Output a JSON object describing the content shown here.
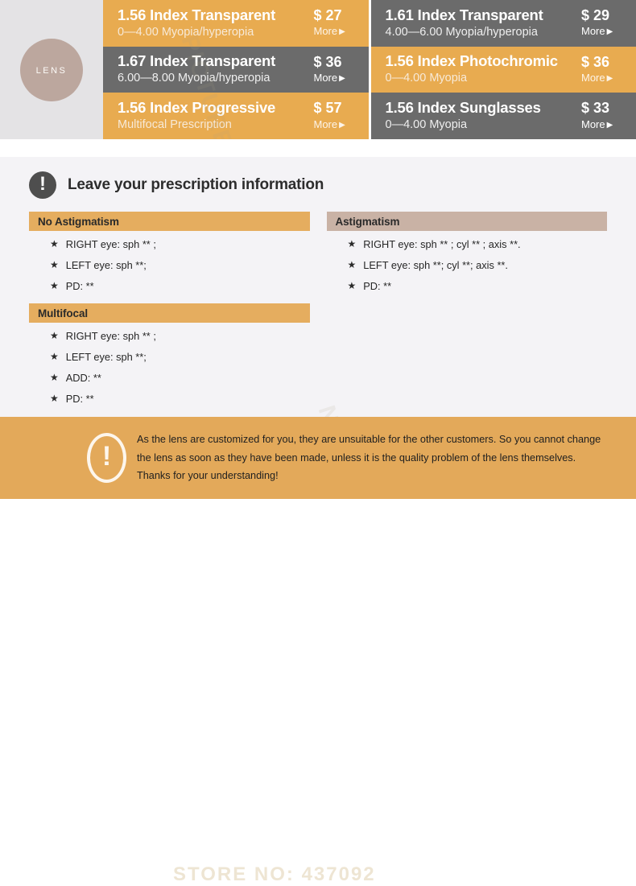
{
  "brand": {
    "badge_label": "LENS"
  },
  "lens_options": [
    {
      "title": "1.56 Index Transparent",
      "subtitle": "0—4.00 Myopia/hyperopia",
      "price": "$ 27",
      "more_label": "More",
      "more_arrow": "▶",
      "theme": "orange"
    },
    {
      "title": "1.61 Index Transparent",
      "subtitle": "4.00—6.00 Myopia/hyperopia",
      "price": "$ 29",
      "more_label": "More",
      "more_arrow": "▶",
      "theme": "gray"
    },
    {
      "title": "1.67 Index Transparent",
      "subtitle": "6.00—8.00 Myopia/hyperopia",
      "price": "$ 36",
      "more_label": "More",
      "more_arrow": "▶",
      "theme": "gray"
    },
    {
      "title": "1.56 Index Photochromic",
      "subtitle": "0—4.00 Myopia",
      "price": "$ 36",
      "more_label": "More",
      "more_arrow": "▶",
      "theme": "orange"
    },
    {
      "title": "1.56 Index Progressive",
      "subtitle": "Multifocal Prescription",
      "price": "$ 57",
      "more_label": "More",
      "more_arrow": "▶",
      "theme": "orange"
    },
    {
      "title": "1.56 Index Sunglasses",
      "subtitle": "0—4.00 Myopia",
      "price": "$ 33",
      "more_label": "More",
      "more_arrow": "▶",
      "theme": "gray"
    }
  ],
  "prescription": {
    "heading": "Leave your prescription information",
    "icon": "exclamation-icon",
    "bullet_glyph": "★",
    "groups": [
      {
        "id": "no-astigmatism",
        "label": "No Astigmatism",
        "bar_color": "#e5ad5f",
        "items": [
          "RIGHT eye:  sph ** ;",
          "LEFT   eye:  sph **;",
          "PD: **"
        ]
      },
      {
        "id": "astigmatism",
        "label": "Astigmatism",
        "bar_color": "#c9b2a5",
        "items": [
          "RIGHT eye:  sph ** ; cyl ** ; axis **.",
          "LEFT   eye:  sph **;  cyl **;  axis **.",
          "PD: **"
        ]
      },
      {
        "id": "multifocal",
        "label": "Multifocal",
        "bar_color": "#e5ad5f",
        "items": [
          "RIGHT eye:  sph ** ;",
          "LEFT   eye:  sph **;",
          "ADD:  **",
          "PD: **"
        ]
      }
    ]
  },
  "notice": {
    "icon": "exclamation-icon",
    "line1": "As the lens are customized for you, they are unsuitable for the other customers. So you cannot  change",
    "line2": "the lens as soon as they have been made, unless it is the quality problem of the lens themselves.",
    "line3": "Thanks for your understanding!"
  },
  "watermarks": {
    "a": "PICTURE NO...",
    "b": "NO: 437092",
    "c": "STORE NO: 437092"
  },
  "colors": {
    "orange": "#e8ab50",
    "gray": "#6b6b6b",
    "taupe": "#c9b2a5",
    "panel_bg": "#f4f3f6",
    "top_bg": "#e4e3e5",
    "notice_bg": "#e3a95a"
  }
}
